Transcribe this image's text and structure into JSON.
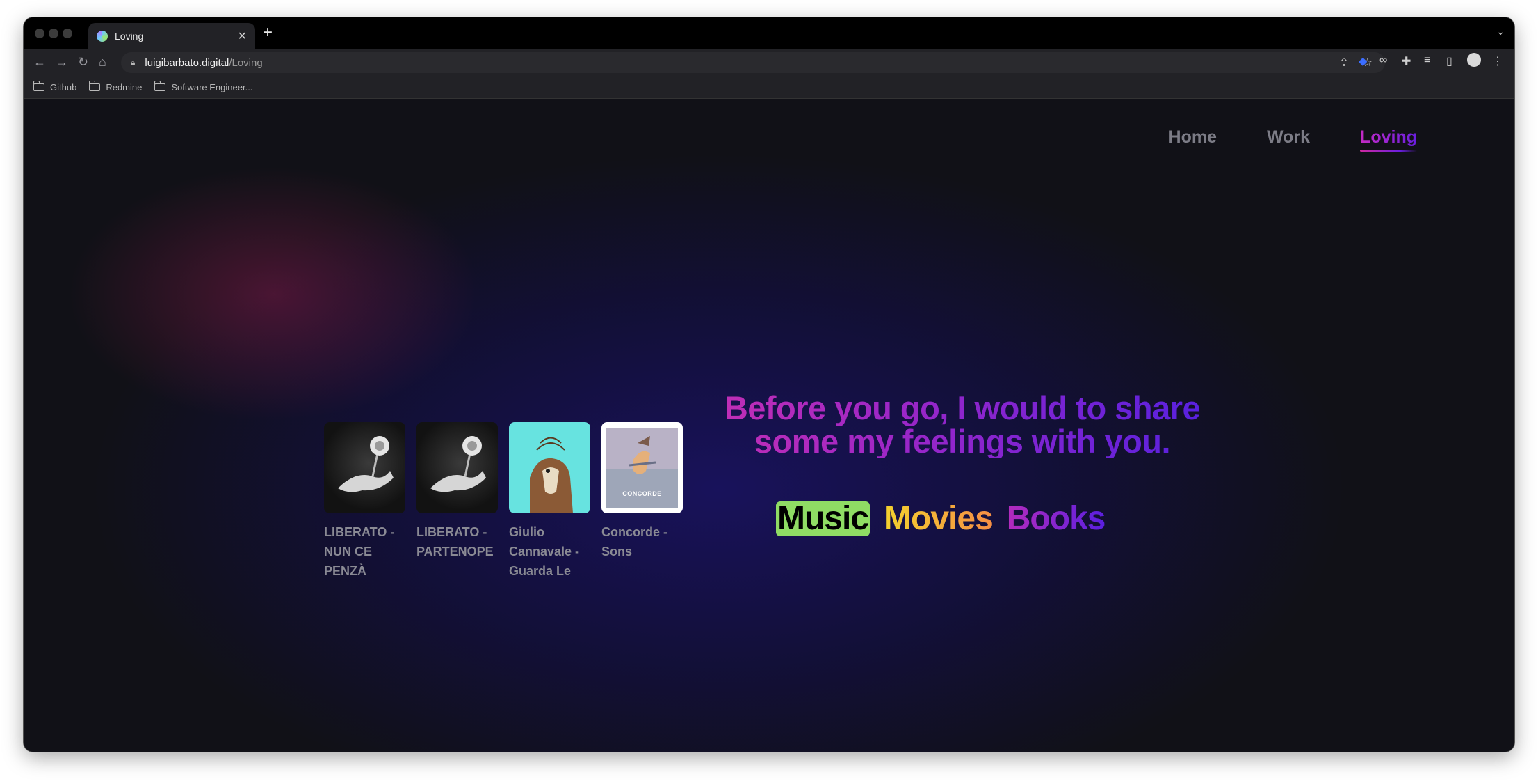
{
  "browser": {
    "tab_title": "Loving",
    "tab_close": "✕",
    "new_tab": "+",
    "url_host": "luigibarbato.digital",
    "url_path": "/Loving",
    "bookmarks": [
      "Github",
      "Redmine",
      "Software Engineer..."
    ]
  },
  "nav": {
    "home": "Home",
    "work": "Work",
    "loving": "Loving"
  },
  "albums": [
    {
      "title": "LIBERATO - NUN CE PENZÀ"
    },
    {
      "title": "LIBERATO - PARTENOPE"
    },
    {
      "title": "Giulio Cannavale - Guarda Le"
    },
    {
      "title": "Concorde - Sons",
      "cover_text": "CONCORDE"
    }
  ],
  "headline": "Before you go, I would to share some my feelings with you.",
  "categories": {
    "music": "Music",
    "movies": "Movies",
    "books": "Books"
  }
}
